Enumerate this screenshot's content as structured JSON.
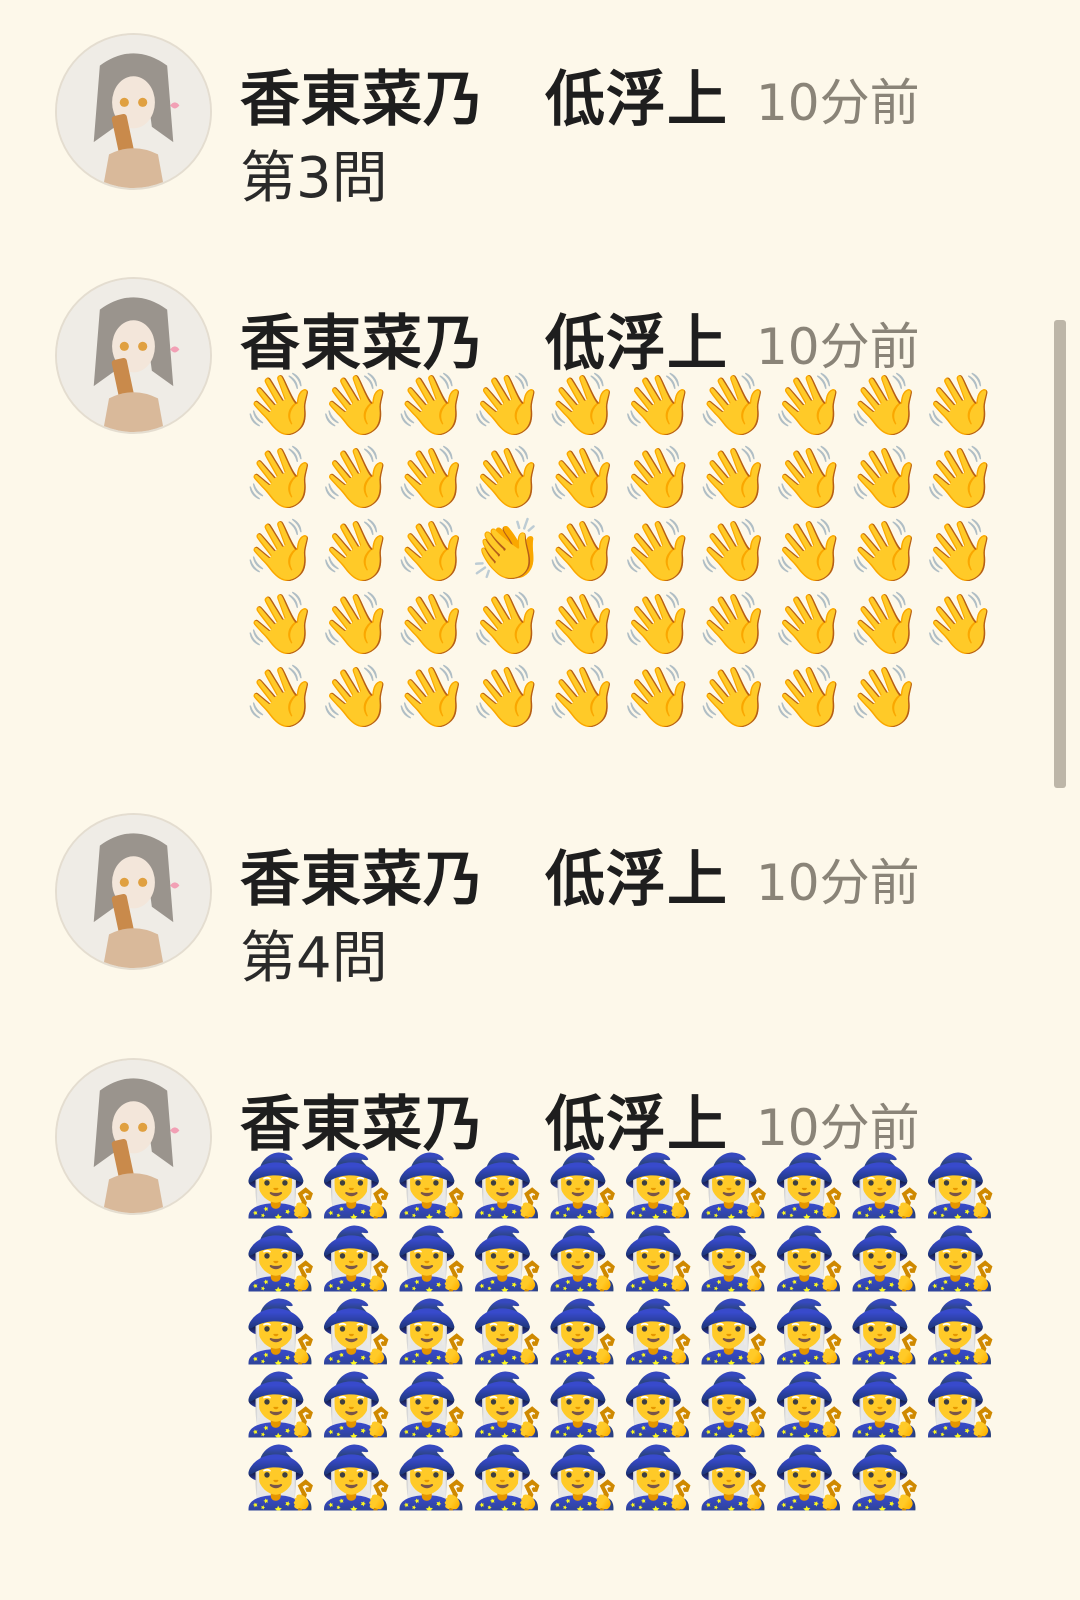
{
  "messages": [
    {
      "author": "香東菜乃　低浮上",
      "time": "10分前",
      "text": "第3問"
    },
    {
      "author": "香東菜乃　低浮上",
      "time": "10分前",
      "emoji": "👋👋👋👋👋👋👋👋👋👋👋👋👋👋👋👋👋👋👋👋👋👋👋👏👋👋👋👋👋👋👋👋👋👋👋👋👋👋👋👋👋👋👋👋👋👋👋👋👋"
    },
    {
      "author": "香東菜乃　低浮上",
      "time": "10分前",
      "text": "第4問"
    },
    {
      "author": "香東菜乃　低浮上",
      "time": "10分前",
      "emoji": "🧙‍♀️🧙‍♀️🧙‍♀️🧙‍♀️🧙‍♀️🧙‍♀️🧙‍♀️🧙‍♀️🧙‍♀️🧙‍♀️🧙‍♀️🧙‍♀️🧙‍♀️🧙‍♀️🧙‍♀️🧙‍♀️🧙‍♀️🧙‍♀️🧙‍♀️🧙‍♀️🧙‍♀️🧙‍♀️🧙‍♀️🧙‍♀️🧙‍♀️🧙‍♀️🧙‍♀️🧙‍♀️🧙‍♀️🧙‍♀️🧙‍♀️🧙‍♀️🧙‍♀️🧙‍♀️🧙‍♀️🧙‍♀️🧙‍♀️🧙‍♀️🧙‍♀️🧙‍♀️🧙‍♀️🧙‍♀️🧙‍♀️🧙‍♀️🧙‍♀️🧙‍♀️🧙‍♀️🧙‍♀️🧙‍♀️"
    }
  ]
}
